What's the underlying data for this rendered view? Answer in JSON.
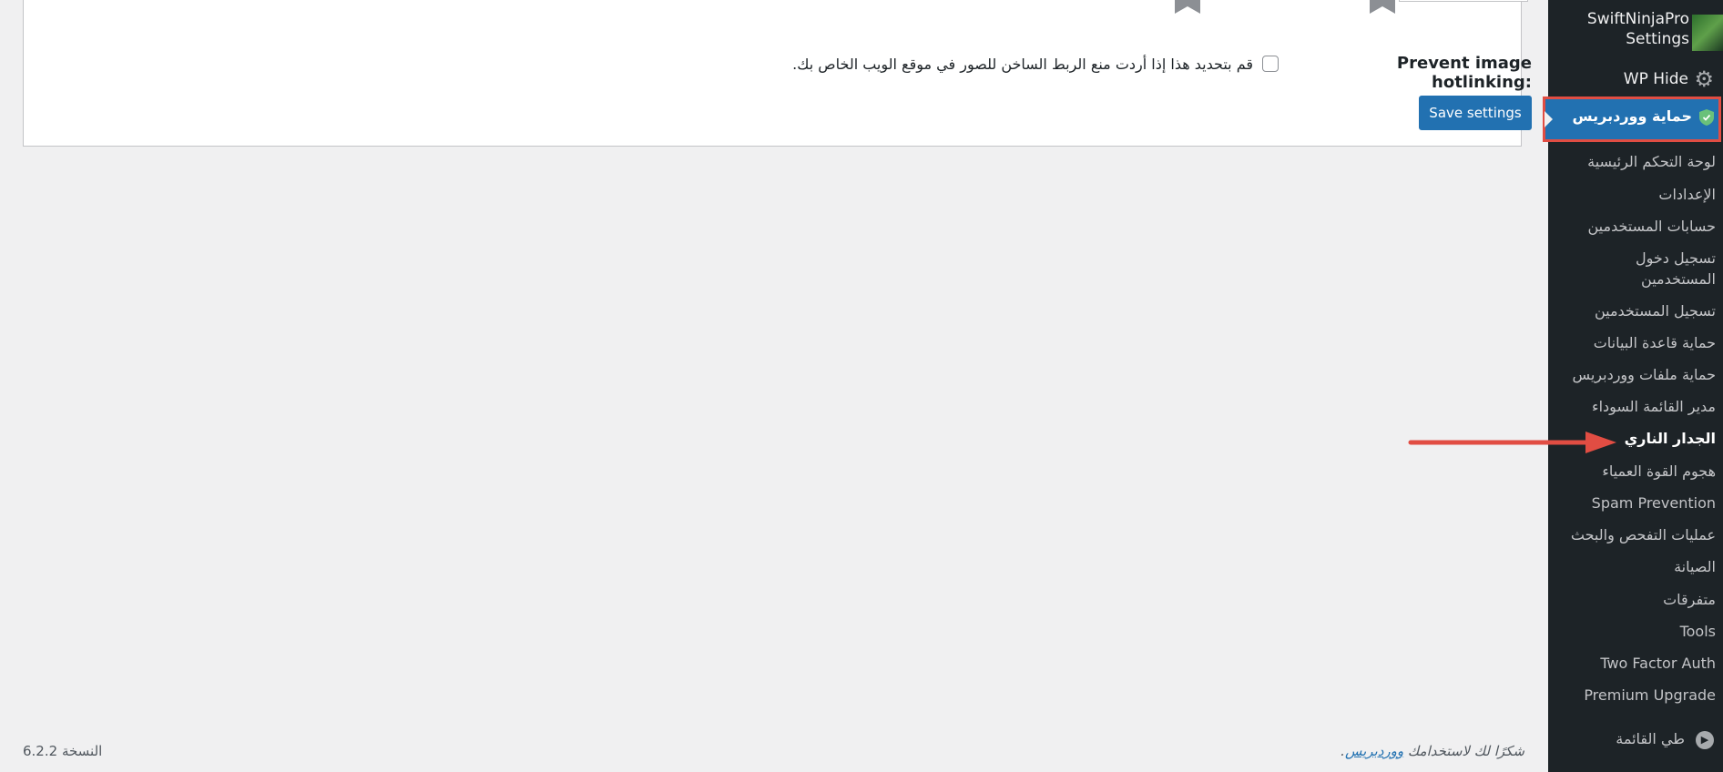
{
  "main": {
    "setting_label": "Prevent image hotlinking:",
    "setting_checked": false,
    "setting_description": "قم بتحديد هذا إذا أردت منع الربط الساخن للصور في موقع الويب الخاص بك.",
    "save_label": "Save settings"
  },
  "footer": {
    "thanks_prefix": "شكرًا لك لاستخدامك ",
    "thanks_link": "ووردبريس",
    "thanks_suffix": ".",
    "version": "النسخة 6.2.2"
  },
  "sidebar": {
    "ninja_label_line1": "SwiftNinjaPro",
    "ninja_label_line2": "Settings",
    "wphide_label": "WP Hide",
    "current_menu_label": "حماية ووردبريس",
    "items": [
      "لوحة التحكم الرئيسية",
      "الإعدادات",
      "حسابات المستخدمين",
      "تسجيل دخول المستخدمين",
      "تسجيل المستخدمين",
      "حماية قاعدة البيانات",
      "حماية ملفات ووردبريس",
      "مدير القائمة السوداء",
      "الجدار الناري",
      "هجوم القوة العمياء",
      "Spam Prevention",
      "عمليات التفحص والبحث",
      "الصيانة",
      "متفرقات",
      "Tools",
      "Two Factor Auth",
      "Premium Upgrade"
    ],
    "active_item_index": 8,
    "collapse_label": "طي القائمة"
  },
  "colors": {
    "sidebar_bg": "#1d2327",
    "accent_blue": "#2271b1",
    "highlight_red": "#e14d43",
    "page_bg": "#f0f0f1"
  },
  "icons": {
    "gear": "gear-icon",
    "shield": "shield-icon",
    "collapse": "collapse-icon",
    "annotation": "arrow-icon"
  }
}
